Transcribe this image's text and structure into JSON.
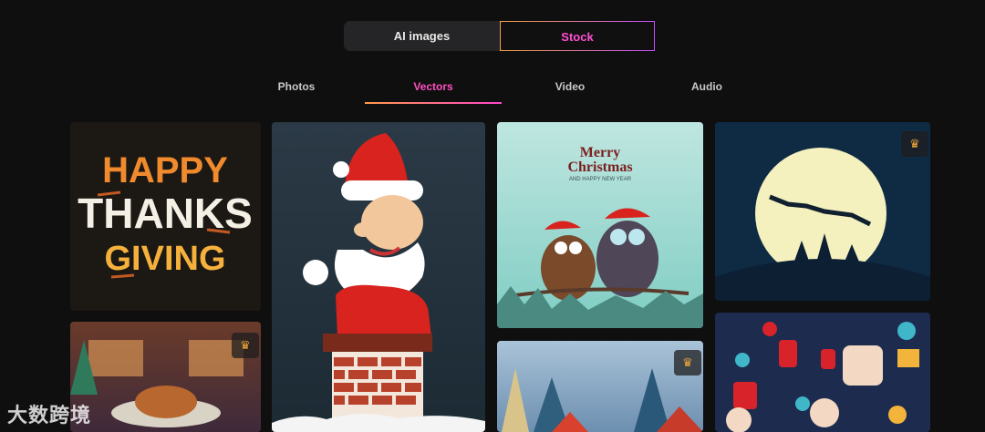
{
  "source_toggle": {
    "ai_images_label": "AI images",
    "stock_label": "Stock"
  },
  "tabs": [
    {
      "label": "Photos"
    },
    {
      "label": "Vectors"
    },
    {
      "label": "Video"
    },
    {
      "label": "Audio"
    }
  ],
  "cards": {
    "thanksgiving": {
      "line1": "HAPPY",
      "line2": "THANKS",
      "line3": "GIVING"
    },
    "owls": {
      "title1": "Merry",
      "title2": "Christmas",
      "subtitle": "AND HAPPY NEW YEAR"
    }
  },
  "watermark": "大数跨境",
  "colors": {
    "accent": "#ff4fbf",
    "background": "#0f0f10"
  }
}
